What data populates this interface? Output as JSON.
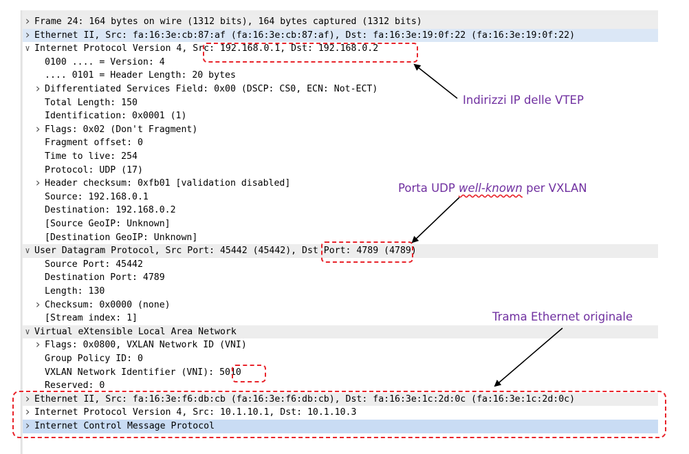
{
  "tree": {
    "rows": [
      {
        "level": 0,
        "exp": ">",
        "text": "Frame 24: 164 bytes on wire (1312 bits), 164 bytes captured (1312 bits)",
        "bg": "sel-grey"
      },
      {
        "level": 0,
        "exp": ">",
        "text": "Ethernet II, Src: fa:16:3e:cb:87:af (fa:16:3e:cb:87:af), Dst: fa:16:3e:19:0f:22 (fa:16:3e:19:0f:22)",
        "bg": "sel-blue"
      },
      {
        "level": 0,
        "exp": "v",
        "text": "Internet Protocol Version 4, Src: 192.168.0.1, Dst: 192.168.0.2",
        "bg": ""
      },
      {
        "level": 1,
        "exp": "",
        "text": "0100 .... = Version: 4",
        "bg": ""
      },
      {
        "level": 1,
        "exp": "",
        "text": ".... 0101 = Header Length: 20 bytes",
        "bg": ""
      },
      {
        "level": 1,
        "exp": ">",
        "text": "Differentiated Services Field: 0x00 (DSCP: CS0, ECN: Not-ECT)",
        "bg": ""
      },
      {
        "level": 1,
        "exp": "",
        "text": "Total Length: 150",
        "bg": ""
      },
      {
        "level": 1,
        "exp": "",
        "text": "Identification: 0x0001 (1)",
        "bg": ""
      },
      {
        "level": 1,
        "exp": ">",
        "text": "Flags: 0x02 (Don't Fragment)",
        "bg": ""
      },
      {
        "level": 1,
        "exp": "",
        "text": "Fragment offset: 0",
        "bg": ""
      },
      {
        "level": 1,
        "exp": "",
        "text": "Time to live: 254",
        "bg": ""
      },
      {
        "level": 1,
        "exp": "",
        "text": "Protocol: UDP (17)",
        "bg": ""
      },
      {
        "level": 1,
        "exp": ">",
        "text": "Header checksum: 0xfb01 [validation disabled]",
        "bg": ""
      },
      {
        "level": 1,
        "exp": "",
        "text": "Source: 192.168.0.1",
        "bg": ""
      },
      {
        "level": 1,
        "exp": "",
        "text": "Destination: 192.168.0.2",
        "bg": ""
      },
      {
        "level": 1,
        "exp": "",
        "text": "[Source GeoIP: Unknown]",
        "bg": ""
      },
      {
        "level": 1,
        "exp": "",
        "text": "[Destination GeoIP: Unknown]",
        "bg": ""
      },
      {
        "level": 0,
        "exp": "v",
        "text": "User Datagram Protocol, Src Port: 45442 (45442), Dst Port: 4789 (4789)",
        "bg": "sel-grey"
      },
      {
        "level": 1,
        "exp": "",
        "text": "Source Port: 45442",
        "bg": ""
      },
      {
        "level": 1,
        "exp": "",
        "text": "Destination Port: 4789",
        "bg": ""
      },
      {
        "level": 1,
        "exp": "",
        "text": "Length: 130",
        "bg": ""
      },
      {
        "level": 1,
        "exp": ">",
        "text": "Checksum: 0x0000 (none)",
        "bg": ""
      },
      {
        "level": 1,
        "exp": "",
        "text": "[Stream index: 1]",
        "bg": ""
      },
      {
        "level": 0,
        "exp": "v",
        "text": "Virtual eXtensible Local Area Network",
        "bg": "sel-grey"
      },
      {
        "level": 1,
        "exp": ">",
        "text": "Flags: 0x0800, VXLAN Network ID (VNI)",
        "bg": ""
      },
      {
        "level": 1,
        "exp": "",
        "text": "Group Policy ID: 0",
        "bg": ""
      },
      {
        "level": 1,
        "exp": "",
        "text": "VXLAN Network Identifier (VNI): 5010",
        "bg": ""
      },
      {
        "level": 1,
        "exp": "",
        "text": "Reserved: 0",
        "bg": ""
      },
      {
        "level": 0,
        "exp": ">",
        "text": "Ethernet II, Src: fa:16:3e:f6:db:cb (fa:16:3e:f6:db:cb), Dst: fa:16:3e:1c:2d:0c (fa:16:3e:1c:2d:0c)",
        "bg": "sel-grey"
      },
      {
        "level": 0,
        "exp": ">",
        "text": "Internet Protocol Version 4, Src: 10.1.10.1, Dst: 10.1.10.3",
        "bg": ""
      },
      {
        "level": 0,
        "exp": ">",
        "text": "Internet Control Message Protocol",
        "bg": "sel-blue2"
      }
    ]
  },
  "annotations": {
    "vtep_ip": "Indirizzi IP delle VTEP",
    "udp_port_pre": "Porta UDP ",
    "udp_port_em": "well-known",
    "udp_port_post": " per VXLAN",
    "orig_frame": "Trama Ethernet originale"
  },
  "colors": {
    "annotation_text": "#7030a0",
    "highlight_dash": "#e8232a",
    "arrow": "#000000"
  }
}
